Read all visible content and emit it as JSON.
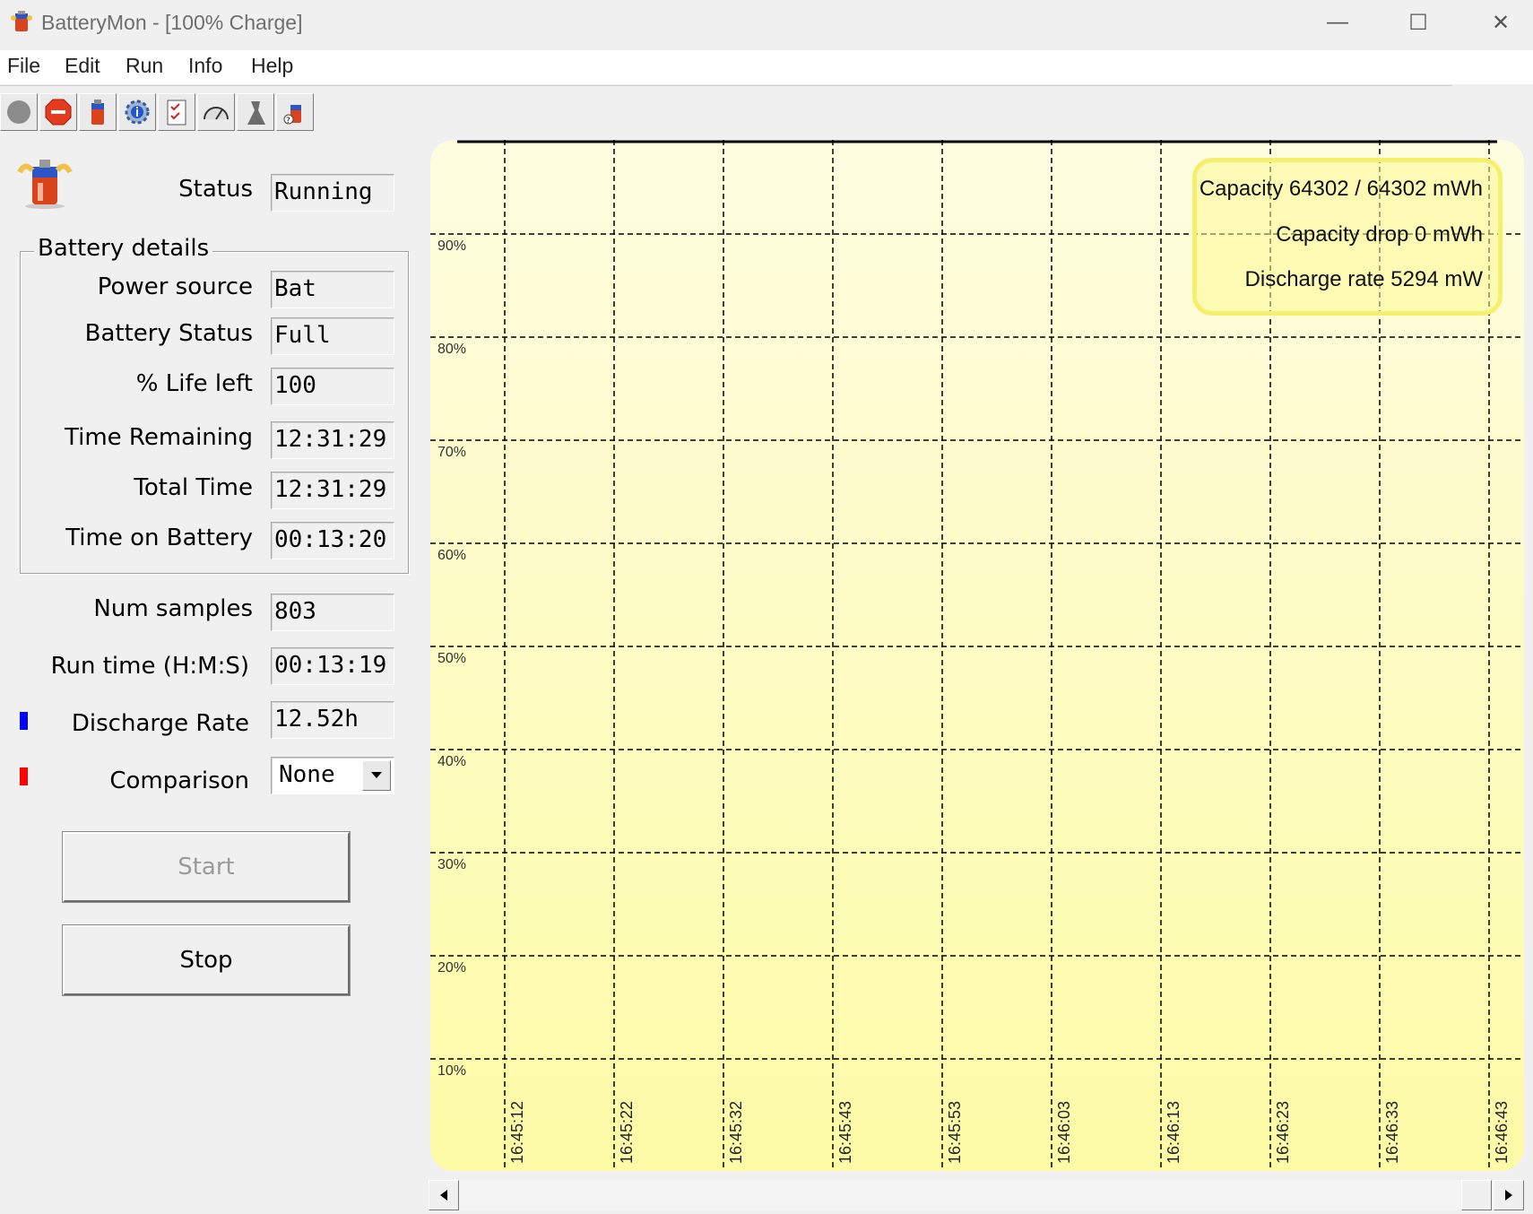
{
  "window": {
    "title": "BatteryMon - [100% Charge]",
    "controls": {
      "minimize": "—",
      "maximize": "☐",
      "close": "✕"
    }
  },
  "menu": [
    "File",
    "Edit",
    "Run",
    "Info",
    "Help"
  ],
  "toolbar_icons": [
    "start-icon",
    "stop-icon",
    "battery-icon",
    "info-icon",
    "checklist-icon",
    "gauge-icon",
    "tools-icon",
    "help-icon"
  ],
  "status": {
    "label": "Status",
    "value": "Running"
  },
  "battery_details": {
    "title": "Battery details",
    "rows": [
      {
        "label": "Power source",
        "value": "Bat"
      },
      {
        "label": "Battery Status",
        "value": "Full"
      },
      {
        "label": "% Life left",
        "value": "100"
      },
      {
        "label": "Time Remaining",
        "value": "12:31:29"
      },
      {
        "label": "Total Time",
        "value": "12:31:29"
      },
      {
        "label": "Time on Battery",
        "value": "00:13:20"
      }
    ]
  },
  "stats": {
    "num_samples": {
      "label": "Num samples",
      "value": "803"
    },
    "run_time": {
      "label": "Run time (H:M:S)",
      "value": "00:13:19"
    },
    "discharge_rate": {
      "label": "Discharge Rate",
      "value": "12.52h",
      "color": "#0000ff"
    },
    "comparison": {
      "label": "Comparison",
      "value": "None",
      "color": "#ff0000"
    }
  },
  "buttons": {
    "start": "Start",
    "stop": "Stop"
  },
  "chart_data": {
    "type": "line",
    "y_ticks": [
      "90%",
      "80%",
      "70%",
      "60%",
      "50%",
      "40%",
      "30%",
      "20%",
      "10%"
    ],
    "x_ticks": [
      "16:45:12",
      "16:45:22",
      "16:45:32",
      "16:45:43",
      "16:45:53",
      "16:46:03",
      "16:46:13",
      "16:46:23",
      "16:46:33",
      "16:46:43"
    ],
    "ylim": [
      0,
      100
    ],
    "grid": true,
    "series": [
      {
        "color": "#0000ff",
        "values": [
          100,
          100,
          100,
          100,
          100,
          100,
          100,
          100,
          100,
          100
        ]
      }
    ],
    "info": [
      "Capacity 64302 / 64302 mWh",
      "Capacity drop 0 mWh",
      "Discharge rate 5294 mW"
    ]
  }
}
